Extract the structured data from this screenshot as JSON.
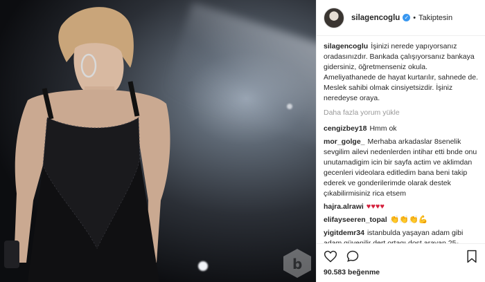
{
  "post": {
    "username": "silagencoglu",
    "follow_status": "Takiptesin",
    "caption": "İşinizi nerede yapıyorsanız oradasınızdır. Bankada çalışıyorsanız bankaya gidersiniz, öğretmenseniz okula. Ameliyathanede de hayat kurtarılır, sahnede de. Meslek sahibi olmak cinsiyetsizdir. İşiniz neredeyse oraya.",
    "load_more": "Daha fazla yorum yükle",
    "comments": [
      {
        "user": "cengizbey18",
        "text": "Hmm ok"
      },
      {
        "user": "mor_golge_",
        "text": "Merhaba arkadaslar 8senelik sevgilim ailevi nedenlerden intihar etti bnde onu unutamadigim icin bir sayfa actim ve aklimdan gecenleri videolara editledim bana beni takip ederek ve gonderilerimde olarak destek çıkabilirmisiniz rica etsem"
      },
      {
        "user": "hajra.alrawi",
        "text": "♥♥♥♥"
      },
      {
        "user": "elifayseeren_topal",
        "text": "👏👏👏💪"
      },
      {
        "user": "yigitdemr34",
        "text": "istanbulda yaşayan adam gibi adam güvenilir dert ortagı dost arayan 25-"
      }
    ],
    "likes": "90.583 beğenme",
    "icons": [
      "heart-icon",
      "comment-icon",
      "bookmark-icon",
      "verified-icon"
    ],
    "colors": {
      "verified": "#3897f0",
      "heart": "#d4213d",
      "muted": "#999999"
    }
  }
}
